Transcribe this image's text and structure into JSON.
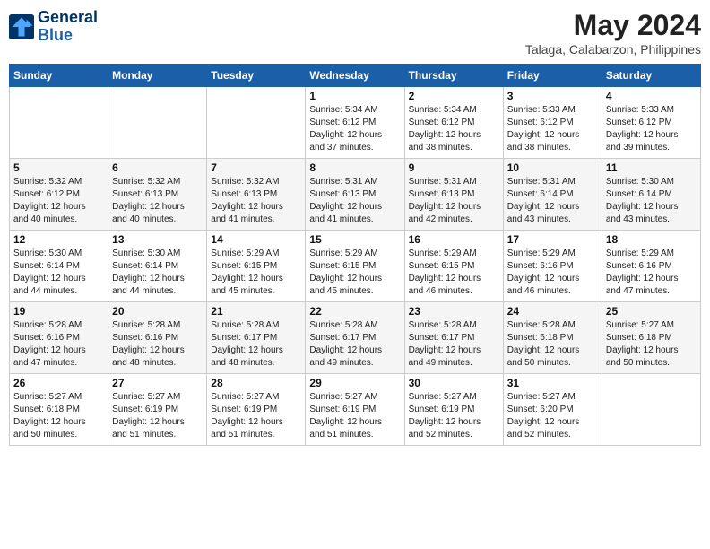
{
  "logo": {
    "line1": "General",
    "line2": "Blue"
  },
  "title": "May 2024",
  "subtitle": "Talaga, Calabarzon, Philippines",
  "weekdays": [
    "Sunday",
    "Monday",
    "Tuesday",
    "Wednesday",
    "Thursday",
    "Friday",
    "Saturday"
  ],
  "weeks": [
    [
      {
        "day": "",
        "info": ""
      },
      {
        "day": "",
        "info": ""
      },
      {
        "day": "",
        "info": ""
      },
      {
        "day": "1",
        "info": "Sunrise: 5:34 AM\nSunset: 6:12 PM\nDaylight: 12 hours\nand 37 minutes."
      },
      {
        "day": "2",
        "info": "Sunrise: 5:34 AM\nSunset: 6:12 PM\nDaylight: 12 hours\nand 38 minutes."
      },
      {
        "day": "3",
        "info": "Sunrise: 5:33 AM\nSunset: 6:12 PM\nDaylight: 12 hours\nand 38 minutes."
      },
      {
        "day": "4",
        "info": "Sunrise: 5:33 AM\nSunset: 6:12 PM\nDaylight: 12 hours\nand 39 minutes."
      }
    ],
    [
      {
        "day": "5",
        "info": "Sunrise: 5:32 AM\nSunset: 6:12 PM\nDaylight: 12 hours\nand 40 minutes."
      },
      {
        "day": "6",
        "info": "Sunrise: 5:32 AM\nSunset: 6:13 PM\nDaylight: 12 hours\nand 40 minutes."
      },
      {
        "day": "7",
        "info": "Sunrise: 5:32 AM\nSunset: 6:13 PM\nDaylight: 12 hours\nand 41 minutes."
      },
      {
        "day": "8",
        "info": "Sunrise: 5:31 AM\nSunset: 6:13 PM\nDaylight: 12 hours\nand 41 minutes."
      },
      {
        "day": "9",
        "info": "Sunrise: 5:31 AM\nSunset: 6:13 PM\nDaylight: 12 hours\nand 42 minutes."
      },
      {
        "day": "10",
        "info": "Sunrise: 5:31 AM\nSunset: 6:14 PM\nDaylight: 12 hours\nand 43 minutes."
      },
      {
        "day": "11",
        "info": "Sunrise: 5:30 AM\nSunset: 6:14 PM\nDaylight: 12 hours\nand 43 minutes."
      }
    ],
    [
      {
        "day": "12",
        "info": "Sunrise: 5:30 AM\nSunset: 6:14 PM\nDaylight: 12 hours\nand 44 minutes."
      },
      {
        "day": "13",
        "info": "Sunrise: 5:30 AM\nSunset: 6:14 PM\nDaylight: 12 hours\nand 44 minutes."
      },
      {
        "day": "14",
        "info": "Sunrise: 5:29 AM\nSunset: 6:15 PM\nDaylight: 12 hours\nand 45 minutes."
      },
      {
        "day": "15",
        "info": "Sunrise: 5:29 AM\nSunset: 6:15 PM\nDaylight: 12 hours\nand 45 minutes."
      },
      {
        "day": "16",
        "info": "Sunrise: 5:29 AM\nSunset: 6:15 PM\nDaylight: 12 hours\nand 46 minutes."
      },
      {
        "day": "17",
        "info": "Sunrise: 5:29 AM\nSunset: 6:16 PM\nDaylight: 12 hours\nand 46 minutes."
      },
      {
        "day": "18",
        "info": "Sunrise: 5:29 AM\nSunset: 6:16 PM\nDaylight: 12 hours\nand 47 minutes."
      }
    ],
    [
      {
        "day": "19",
        "info": "Sunrise: 5:28 AM\nSunset: 6:16 PM\nDaylight: 12 hours\nand 47 minutes."
      },
      {
        "day": "20",
        "info": "Sunrise: 5:28 AM\nSunset: 6:16 PM\nDaylight: 12 hours\nand 48 minutes."
      },
      {
        "day": "21",
        "info": "Sunrise: 5:28 AM\nSunset: 6:17 PM\nDaylight: 12 hours\nand 48 minutes."
      },
      {
        "day": "22",
        "info": "Sunrise: 5:28 AM\nSunset: 6:17 PM\nDaylight: 12 hours\nand 49 minutes."
      },
      {
        "day": "23",
        "info": "Sunrise: 5:28 AM\nSunset: 6:17 PM\nDaylight: 12 hours\nand 49 minutes."
      },
      {
        "day": "24",
        "info": "Sunrise: 5:28 AM\nSunset: 6:18 PM\nDaylight: 12 hours\nand 50 minutes."
      },
      {
        "day": "25",
        "info": "Sunrise: 5:27 AM\nSunset: 6:18 PM\nDaylight: 12 hours\nand 50 minutes."
      }
    ],
    [
      {
        "day": "26",
        "info": "Sunrise: 5:27 AM\nSunset: 6:18 PM\nDaylight: 12 hours\nand 50 minutes."
      },
      {
        "day": "27",
        "info": "Sunrise: 5:27 AM\nSunset: 6:19 PM\nDaylight: 12 hours\nand 51 minutes."
      },
      {
        "day": "28",
        "info": "Sunrise: 5:27 AM\nSunset: 6:19 PM\nDaylight: 12 hours\nand 51 minutes."
      },
      {
        "day": "29",
        "info": "Sunrise: 5:27 AM\nSunset: 6:19 PM\nDaylight: 12 hours\nand 51 minutes."
      },
      {
        "day": "30",
        "info": "Sunrise: 5:27 AM\nSunset: 6:19 PM\nDaylight: 12 hours\nand 52 minutes."
      },
      {
        "day": "31",
        "info": "Sunrise: 5:27 AM\nSunset: 6:20 PM\nDaylight: 12 hours\nand 52 minutes."
      },
      {
        "day": "",
        "info": ""
      }
    ]
  ]
}
